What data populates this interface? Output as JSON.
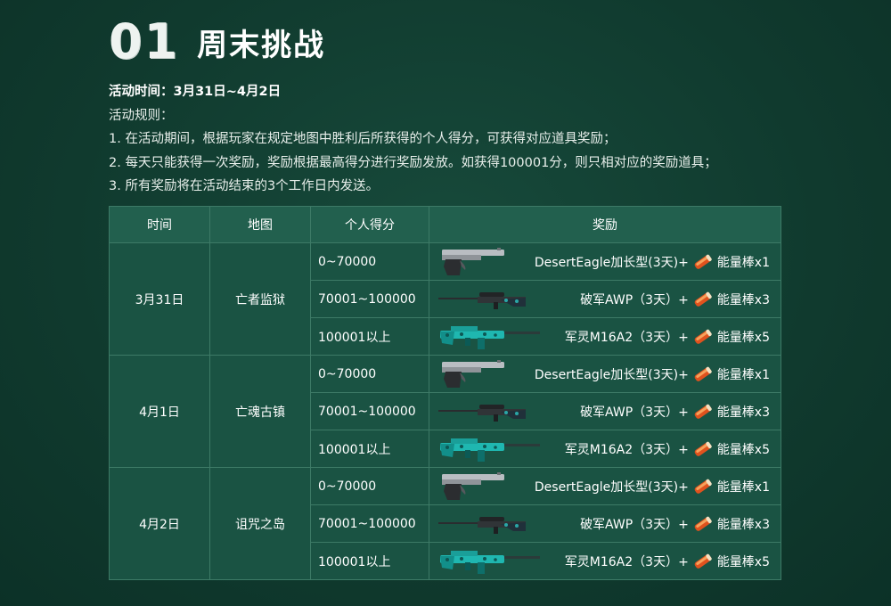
{
  "header": {
    "number": "01",
    "title": "周末挑战"
  },
  "info": {
    "time_label": "活动时间：",
    "time_value": "3月31日~4月2日",
    "rules_title": "活动规则：",
    "rules": [
      "1. 在活动期间，根据玩家在规定地图中胜利后所获得的个人得分，可获得对应道具奖励；",
      "2. 每天只能获得一次奖励，奖励根据最高得分进行奖励发放。如获得100001分，则只相对应的奖励道具；",
      "3. 所有奖励将在活动结束的3个工作日内发送。"
    ]
  },
  "table": {
    "headers": [
      "时间",
      "地图",
      "个人得分",
      "奖励"
    ],
    "days": [
      {
        "date": "3月31日",
        "map": "亡者监狱",
        "tiers": [
          {
            "score": "0~70000",
            "weapon_icon": "pistol-icon",
            "weapon": "DesertEagle加长型(3天)+",
            "item": "能量棒x1"
          },
          {
            "score": "70001~100000",
            "weapon_icon": "sniper-rifle-icon",
            "weapon": "破军AWP（3天）+",
            "item": "能量棒x3"
          },
          {
            "score": "100001以上",
            "weapon_icon": "assault-rifle-icon",
            "weapon": "军灵M16A2（3天）+",
            "item": "能量棒x5"
          }
        ]
      },
      {
        "date": "4月1日",
        "map": "亡魂古镇",
        "tiers": [
          {
            "score": "0~70000",
            "weapon_icon": "pistol-icon",
            "weapon": "DesertEagle加长型(3天)+",
            "item": "能量棒x1"
          },
          {
            "score": "70001~100000",
            "weapon_icon": "sniper-rifle-icon",
            "weapon": "破军AWP（3天）+",
            "item": "能量棒x3"
          },
          {
            "score": "100001以上",
            "weapon_icon": "assault-rifle-icon",
            "weapon": "军灵M16A2（3天）+",
            "item": "能量棒x5"
          }
        ]
      },
      {
        "date": "4月2日",
        "map": "诅咒之岛",
        "tiers": [
          {
            "score": "0~70000",
            "weapon_icon": "pistol-icon",
            "weapon": "DesertEagle加长型(3天)+",
            "item": "能量棒x1"
          },
          {
            "score": "70001~100000",
            "weapon_icon": "sniper-rifle-icon",
            "weapon": "破军AWP（3天）+",
            "item": "能量棒x3"
          },
          {
            "score": "100001以上",
            "weapon_icon": "assault-rifle-icon",
            "weapon": "军灵M16A2（3天）+",
            "item": "能量棒x5"
          }
        ]
      }
    ]
  },
  "colors": {
    "background": "#103a2e",
    "header_cell": "#22604e",
    "body_cell": "#1a5343",
    "border": "#3d7a66",
    "energy_item": "#e0521e"
  }
}
